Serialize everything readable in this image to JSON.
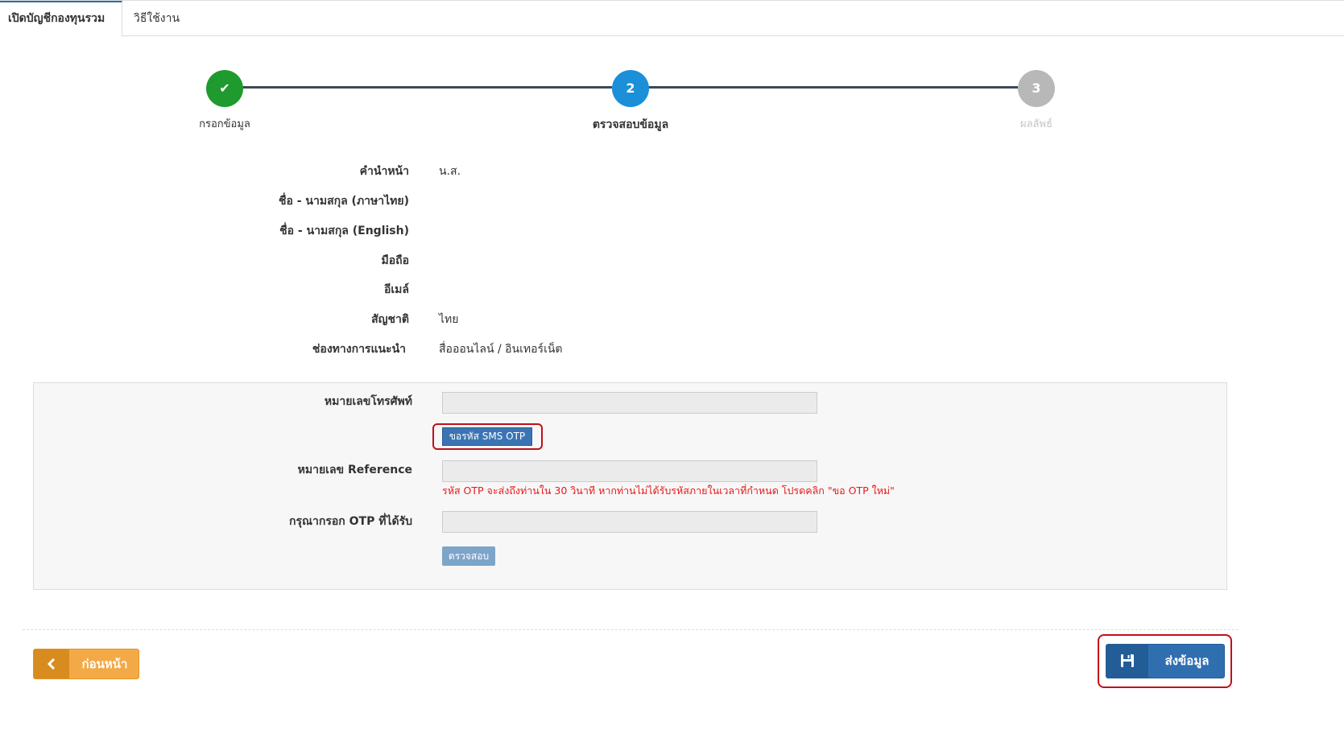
{
  "tabs": [
    {
      "label": "เปิดบัญชีกองทุนรวม"
    },
    {
      "label": "วิธีใช้งาน"
    }
  ],
  "stepper": {
    "steps": [
      {
        "number": "✔",
        "label": "กรอกข้อมูล",
        "color": "#1f9a2e"
      },
      {
        "number": "2",
        "label": "ตรวจสอบข้อมูล",
        "color": "#1b8fd8"
      },
      {
        "number": "3",
        "label": "ผลลัพธ์",
        "color": "#b8b8b8"
      }
    ]
  },
  "info": {
    "rows": [
      {
        "label": "คำนำหน้า",
        "value": "น.ส."
      },
      {
        "label": "ชื่อ - นามสกุล (ภาษาไทย)",
        "value": ""
      },
      {
        "label": "ชื่อ - นามสกุล (English)",
        "value": ""
      },
      {
        "label": "มือถือ",
        "value": ""
      },
      {
        "label": "อีเมล์",
        "value": ""
      },
      {
        "label": "สัญชาติ",
        "value": "ไทย"
      },
      {
        "label": "ช่องทางการแนะนำ",
        "value": "สื่อออนไลน์ / อินเทอร์เน็ต"
      }
    ]
  },
  "otp_form": {
    "phone_label": "หมายเลขโทรศัพท์",
    "phone_value": "",
    "sms_button": "ขอรหัส SMS OTP",
    "reference_label": "หมายเลข Reference",
    "reference_value": "",
    "note": "รหัส OTP จะส่งถึงท่านใน 30 วินาที หากท่านไม่ได้รับรหัสภายในเวลาที่กำหนด โปรดคลิก \"ขอ OTP ใหม่\"",
    "otp_label": "กรุณากรอก OTP ที่ได้รับ",
    "otp_value": "",
    "check_button": "ตรวจสอบ"
  },
  "footer": {
    "prev_button": "ก่อนหน้า",
    "submit_button": "ส่งข้อมูล",
    "prev_icon": "chevron-left-icon",
    "submit_icon": "save-icon"
  }
}
